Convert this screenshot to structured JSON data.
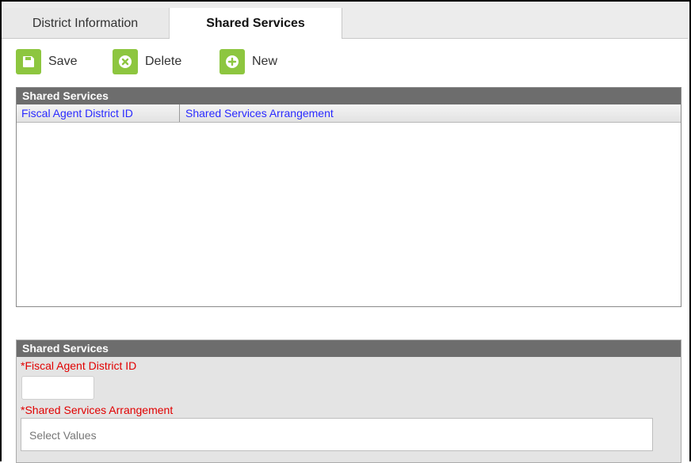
{
  "tabs": {
    "district_information": "District Information",
    "shared_services": "Shared Services"
  },
  "toolbar": {
    "save_label": "Save",
    "delete_label": "Delete",
    "new_label": "New"
  },
  "list": {
    "title": "Shared Services",
    "columns": [
      "Fiscal Agent District ID",
      "Shared Services Arrangement"
    ],
    "rows": []
  },
  "form": {
    "title": "Shared Services",
    "fiscal_agent_label": "*Fiscal Agent District ID",
    "fiscal_agent_value": "",
    "arrangement_label": "*Shared Services Arrangement",
    "arrangement_placeholder": "Select Values"
  },
  "colors": {
    "accent_green": "#8dc63f",
    "header_gray": "#6d6d6d",
    "required_red": "#e10000",
    "column_link_blue": "#2a2aff"
  }
}
